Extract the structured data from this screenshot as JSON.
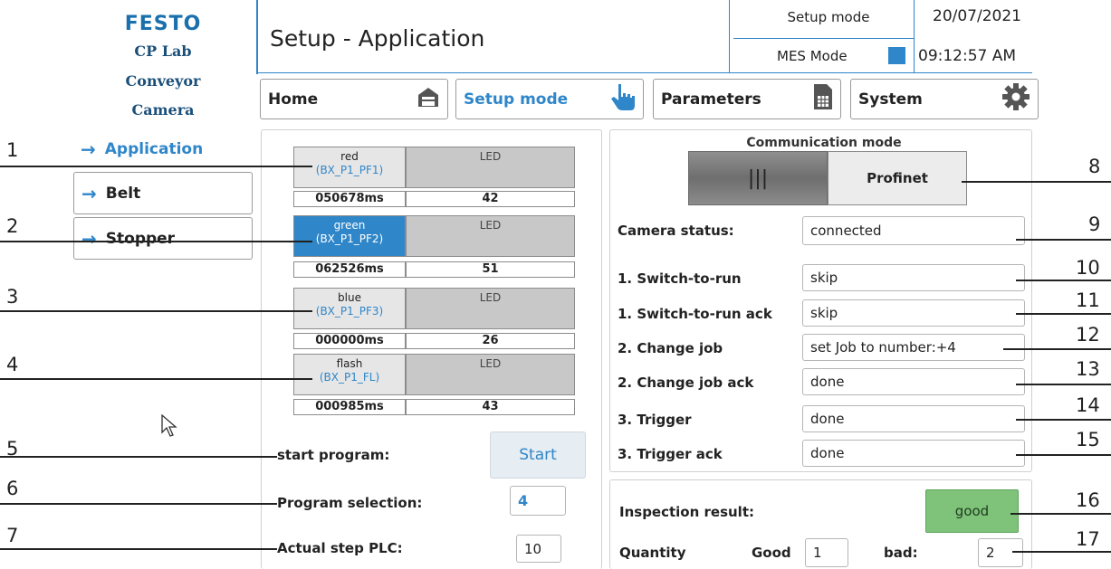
{
  "brand": {
    "logo": "FESTO",
    "line1": "CP Lab",
    "line2": "Conveyor",
    "line3": "Camera"
  },
  "header": {
    "title": "Setup - Application",
    "mode": "Setup mode",
    "mes_mode": "MES Mode",
    "date": "20/07/2021",
    "time": "09:12:57 AM"
  },
  "topnav": [
    {
      "label": "Home",
      "icon": "home-icon"
    },
    {
      "label": "Setup mode",
      "icon": "hand-pointer-icon"
    },
    {
      "label": "Parameters",
      "icon": "document-icon"
    },
    {
      "label": "System",
      "icon": "gear-icon"
    }
  ],
  "sidebar": [
    {
      "label": "Application"
    },
    {
      "label": "Belt"
    },
    {
      "label": "Stopper"
    }
  ],
  "leds": [
    {
      "name": "red",
      "sub": "(BX_P1_PF1)",
      "box": "LED",
      "time": "050678ms",
      "value": "42",
      "active": false
    },
    {
      "name": "green",
      "sub": "(BX_P1_PF2)",
      "box": "LED",
      "time": "062526ms",
      "value": "51",
      "active": true
    },
    {
      "name": "blue",
      "sub": "(BX_P1_PF3)",
      "box": "LED",
      "time": "000000ms",
      "value": "26",
      "active": false
    },
    {
      "name": "flash",
      "sub": "(BX_P1_FL)",
      "box": "LED",
      "time": "000985ms",
      "value": "43",
      "active": false
    }
  ],
  "program": {
    "start_label": "start program:",
    "start_button": "Start",
    "selection_label": "Program selection:",
    "selection_value": "4",
    "step_label": "Actual step PLC:",
    "step_value": "10"
  },
  "communication": {
    "title": "Communication mode",
    "toggle_left": "|||",
    "toggle_right": "Profinet"
  },
  "camera": {
    "status_label": "Camera status:",
    "status_value": "connected",
    "rows": [
      {
        "label": "1. Switch-to-run",
        "value": "skip"
      },
      {
        "label": "1. Switch-to-run ack",
        "value": "skip"
      },
      {
        "label": "2. Change job",
        "value": "set Job to number:+4"
      },
      {
        "label": "2. Change job  ack",
        "value": "done"
      },
      {
        "label": "3. Trigger",
        "value": "done"
      },
      {
        "label": "3. Trigger ack",
        "value": "done"
      }
    ]
  },
  "inspection": {
    "label": "Inspection result:",
    "value": "good",
    "quantity_label": "Quantity",
    "good_label": "Good",
    "good_value": "1",
    "bad_label": "bad:",
    "bad_value": "2"
  },
  "callouts": [
    "1",
    "2",
    "3",
    "4",
    "5",
    "6",
    "7",
    "8",
    "9",
    "10",
    "11",
    "12",
    "13",
    "14",
    "15",
    "16",
    "17"
  ],
  "colors": {
    "accent": "#2f86c9",
    "good": "#7fc37a",
    "active_led": "#2f86c9"
  }
}
